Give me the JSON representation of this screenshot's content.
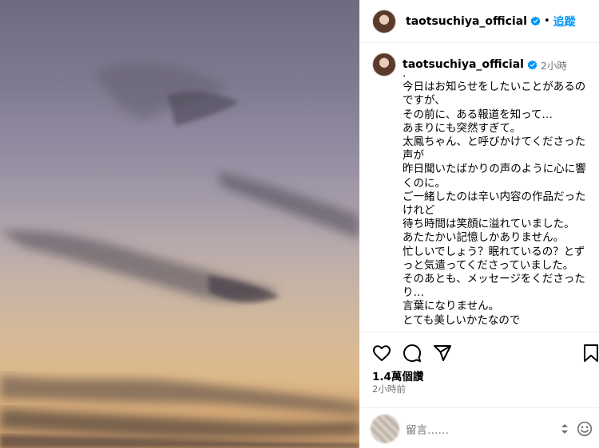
{
  "post": {
    "username": "taotsuchiya_official",
    "follow_label": "追蹤",
    "dot": "•",
    "time_inline": "2小時",
    "caption": ".\n今日はお知らせをしたいことがあるのですが、\nその前に、ある報道を知って…\nあまりにも突然すぎて。\n太鳳ちゃん、と呼びかけてくださった声が\n昨日聞いたばかりの声のように心に響くのに。\nご一緒したのは辛い内容の作品だったけれど\n待ち時間は笑顔に溢れていました。\nあたたかい記憶しかありません。\n忙しいでしょう？眠れているの？とずっと気遣ってくださっていました。\nそのあとも、メッセージをくださったり…\n言葉になりません。\nとても美しいかたなので",
    "likes": "1.4萬個讚",
    "time": "2小時前"
  },
  "comment": {
    "placeholder": "留言……"
  },
  "icons": {
    "verified": "verified-badge-icon",
    "more": "more-options-icon",
    "like": "heart-icon",
    "comment": "comment-bubble-icon",
    "share": "paper-plane-icon",
    "save": "bookmark-icon",
    "emoji": "emoji-icon"
  },
  "colors": {
    "accent": "#0095f6",
    "muted": "#737373"
  }
}
